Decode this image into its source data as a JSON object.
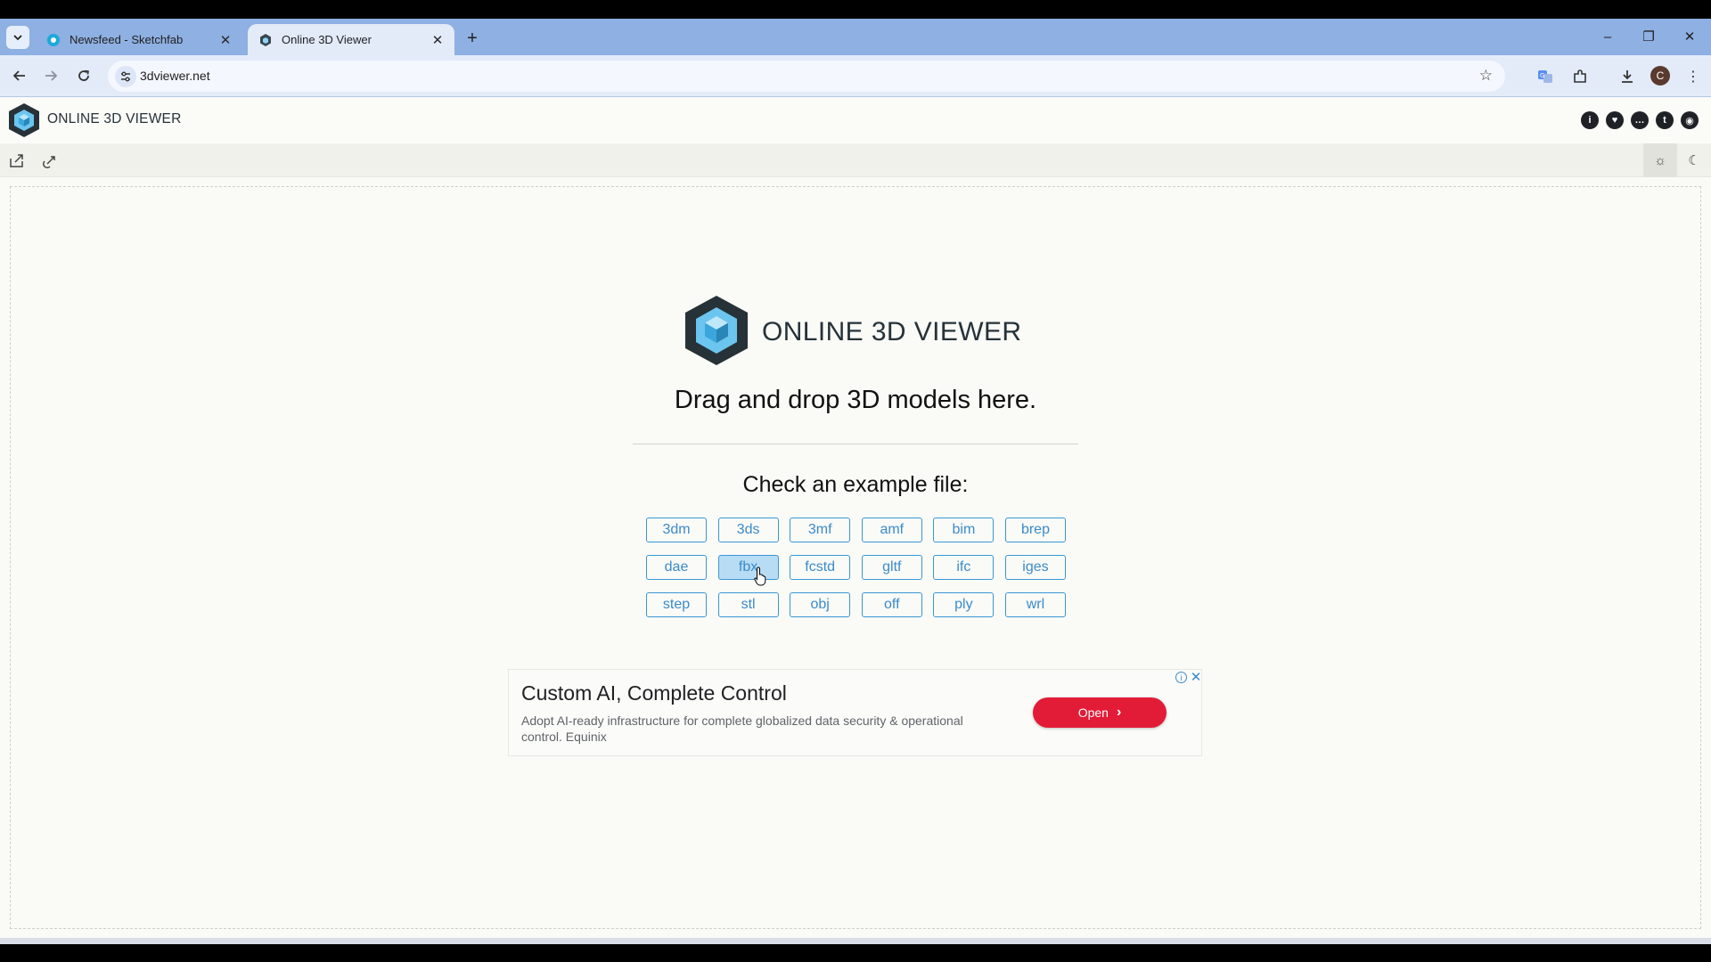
{
  "browser": {
    "tabs": [
      {
        "title": "Newsfeed - Sketchfab",
        "active": false
      },
      {
        "title": "Online 3D Viewer",
        "active": true
      }
    ],
    "url": "3dviewer.net",
    "profile_initial": "C",
    "window_controls": {
      "minimize": "–",
      "restore": "❐",
      "close": "✕"
    }
  },
  "app": {
    "title": "ONLINE 3D VIEWER",
    "header_icons": [
      "info-icon",
      "heart-icon",
      "chat-icon",
      "twitter-icon",
      "github-icon"
    ],
    "toolbar": {
      "open_icon": "open-file-icon",
      "open_url_icon": "open-url-icon",
      "theme_light_icon": "sun-icon",
      "theme_dark_icon": "moon-icon"
    }
  },
  "intro": {
    "title": "ONLINE 3D VIEWER",
    "subtitle": "Drag and drop 3D models here.",
    "example_title": "Check an example file:",
    "examples": [
      "3dm",
      "3ds",
      "3mf",
      "amf",
      "bim",
      "brep",
      "dae",
      "fbx",
      "fcstd",
      "gltf",
      "ifc",
      "iges",
      "step",
      "stl",
      "obj",
      "off",
      "ply",
      "wrl"
    ],
    "hovered": "fbx"
  },
  "ad": {
    "title": "Custom AI, Complete Control",
    "description": "Adopt AI-ready infrastructure for complete globalized data security & operational control. Equinix",
    "button": "Open",
    "button_chevron": "›"
  },
  "colors": {
    "accent": "#3a8bc9",
    "tabstrip": "#8eb0e2",
    "ad_button": "#e21b37",
    "logo_dark": "#263238",
    "logo_light": "#6cc5ef"
  }
}
